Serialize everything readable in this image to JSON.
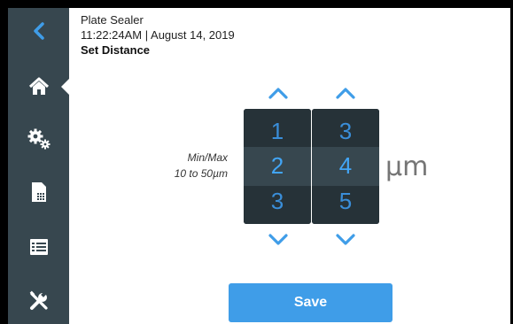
{
  "header": {
    "device_name": "Plate Sealer",
    "datetime": "11:22:24AM | August 14, 2019",
    "page_title": "Set Distance"
  },
  "sidebar": {
    "items": [
      {
        "icon": "back-arrow-icon",
        "active": false
      },
      {
        "icon": "home-icon",
        "active": true
      },
      {
        "icon": "settings-gears-icon",
        "active": false
      },
      {
        "icon": "plate-icon",
        "active": false
      },
      {
        "icon": "list-icon",
        "active": false
      },
      {
        "icon": "tools-icon",
        "active": false
      }
    ]
  },
  "minmax": {
    "label": "Min/Max",
    "range": "10 to 50µm"
  },
  "wheels": [
    {
      "prev": "1",
      "current": "2",
      "next": "3"
    },
    {
      "prev": "3",
      "current": "4",
      "next": "5"
    }
  ],
  "unit": "µm",
  "save_label": "Save",
  "colors": {
    "sidebar": "#37474f",
    "accent": "#3f9de8",
    "wheel_bg": "#263238"
  }
}
